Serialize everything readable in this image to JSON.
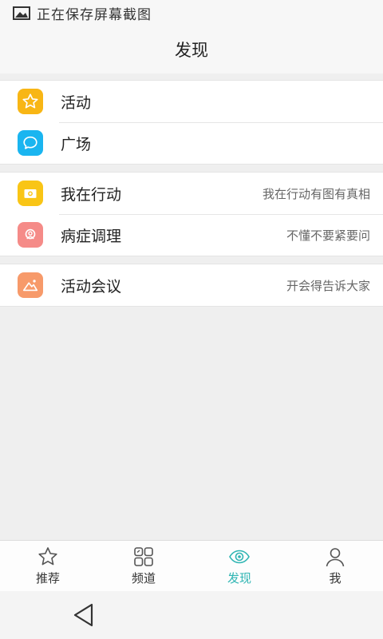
{
  "status_bar": {
    "text": "正在保存屏幕截图",
    "icon": "image-icon"
  },
  "header": {
    "title": "发现"
  },
  "groups": [
    {
      "items": [
        {
          "label": "活动",
          "desc": "",
          "icon": "star-icon",
          "color": "#f8b615"
        },
        {
          "label": "广场",
          "desc": "",
          "icon": "chat-bubble-icon",
          "color": "#1ab5f0"
        }
      ]
    },
    {
      "items": [
        {
          "label": "我在行动",
          "desc": "我在行动有图有真相",
          "icon": "camera-icon",
          "color": "#f9c516"
        },
        {
          "label": "病症调理",
          "desc": "不懂不要紧要问",
          "icon": "doctor-icon",
          "color": "#f58b88"
        }
      ]
    },
    {
      "items": [
        {
          "label": "活动会议",
          "desc": "开会得告诉大家",
          "icon": "mountain-icon",
          "color": "#f79a6a"
        }
      ]
    }
  ],
  "tabs": [
    {
      "label": "推荐",
      "icon": "star-outline-icon",
      "active": false
    },
    {
      "label": "频道",
      "icon": "grid-icon",
      "active": false
    },
    {
      "label": "发现",
      "icon": "eye-icon",
      "active": true
    },
    {
      "label": "我",
      "icon": "user-icon",
      "active": false
    }
  ],
  "colors": {
    "accent": "#2fb5b3",
    "background": "#efefef"
  }
}
